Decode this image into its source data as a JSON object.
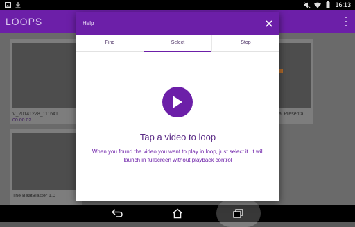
{
  "statusbar": {
    "clock": "16:13",
    "left_icons": [
      "image-icon",
      "download-icon"
    ],
    "right_icons": [
      "mute-icon",
      "wifi-icon",
      "battery-icon"
    ]
  },
  "appbar": {
    "title": "LOOPS",
    "overflow_icon": "more-vertical-icon"
  },
  "videos": [
    {
      "name": "V_20141228_111641",
      "duration": "00:00:02"
    },
    {
      "name": "al Presenta...",
      "duration": ""
    },
    {
      "name": "The BeatBlaster 1.0",
      "duration": ""
    }
  ],
  "dialog": {
    "title": "Help",
    "close_icon": "close-icon",
    "tabs": [
      {
        "label": "Find",
        "active": false
      },
      {
        "label": "Select",
        "active": true
      },
      {
        "label": "Stop",
        "active": false
      }
    ],
    "play_icon": "play-icon",
    "heading": "Tap a video to loop",
    "body": "When you found the video you want to play in loop, just select it. It will launch in fullscreen without playback control"
  },
  "navbar": {
    "back_icon": "back-icon",
    "home_icon": "home-icon",
    "recents_icon": "recents-icon"
  },
  "colors": {
    "accent": "#6c1fa8",
    "heading_text": "#5a2a85",
    "body_text": "#6c1fa8"
  }
}
